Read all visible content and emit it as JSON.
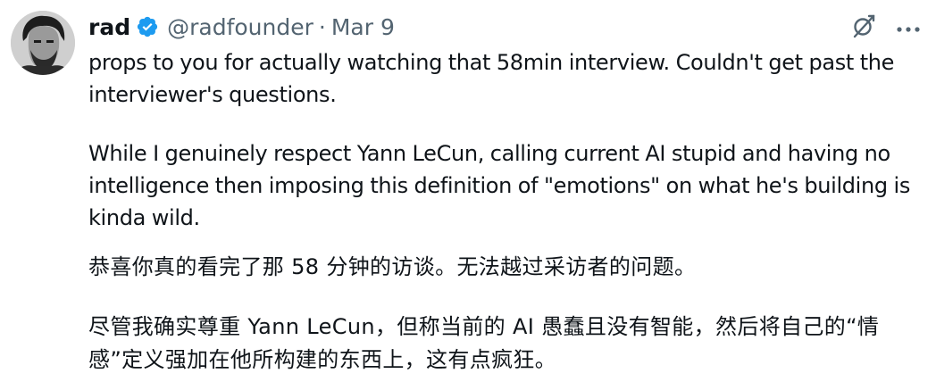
{
  "author": {
    "display_name": "rad",
    "handle": "@radfounder",
    "separator": "·",
    "date": "Mar 9",
    "verified": true
  },
  "icons": {
    "avatar": "avatar-illustration",
    "verified": "verified-badge-icon",
    "grok": "grok-icon",
    "more": "more-icon"
  },
  "colors": {
    "text": "#0f1419",
    "secondary": "#536471",
    "verified": "#1d9bf0"
  },
  "tweet": {
    "paragraphs": [
      "props to you for actually watching that 58min interview. Couldn't get past the interviewer's questions.",
      "While I genuinely respect Yann LeCun, calling current AI stupid and having no intelligence then imposing this definition of \"emotions\" on what he's building is kinda wild."
    ]
  },
  "translation": {
    "paragraphs": [
      "恭喜你真的看完了那 58 分钟的访谈。无法越过采访者的问题。",
      "尽管我确实尊重 Yann LeCun，但称当前的 AI 愚蠢且没有智能，然后将自己的“情感”定义强加在他所构建的东西上，这有点疯狂。"
    ]
  }
}
